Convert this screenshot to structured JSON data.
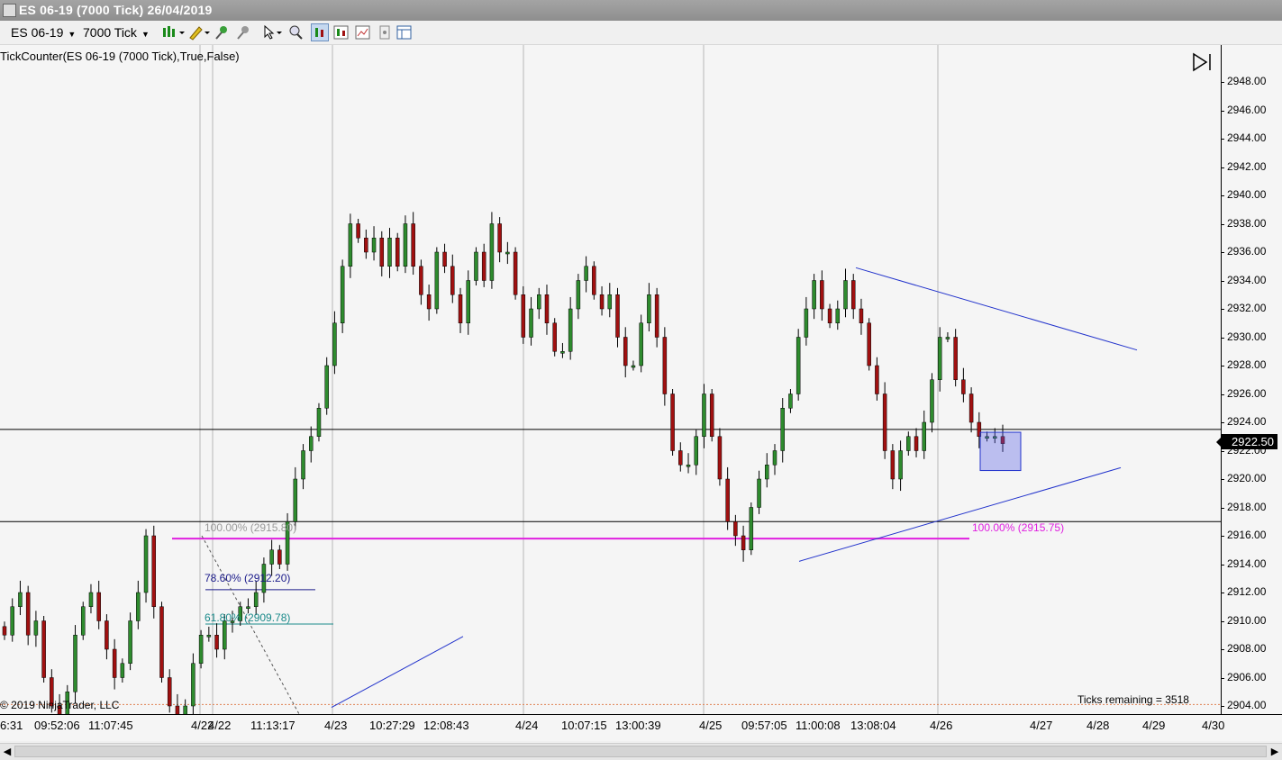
{
  "window": {
    "title": "ES 06-19 (7000 Tick)  26/04/2019"
  },
  "toolbar": {
    "instrument": "ES 06-19",
    "interval": "7000 Tick",
    "icons": [
      "bar-style-icon",
      "drawing-pencil-icon",
      "pin-icon",
      "pin-alt-icon",
      "cursor-icon",
      "zoom-icon",
      "chart-type-icon",
      "candlestick-icon",
      "data-box-icon",
      "properties-icon",
      "layout-icon"
    ]
  },
  "indicator": {
    "label": "TickCounter(ES  06-19 (7000  Tick),True,False)"
  },
  "panel": {
    "f_button": "F"
  },
  "y_axis": {
    "labels": [
      "2948.00",
      "2946.00",
      "2944.00",
      "2942.00",
      "2940.00",
      "2938.00",
      "2936.00",
      "2934.00",
      "2932.00",
      "2930.00",
      "2928.00",
      "2926.00",
      "2924.00",
      "2922.00",
      "2920.00",
      "2918.00",
      "2916.00",
      "2914.00",
      "2912.00",
      "2910.00",
      "2908.00",
      "2906.00",
      "2904.00"
    ],
    "current_price": "2922.50"
  },
  "x_axis": {
    "labels": [
      "6:31",
      "09:52:06",
      "11:07:45",
      "4/22",
      "4/22",
      "11:13:17",
      "4/23",
      "10:27:29",
      "12:08:43",
      "4/24",
      "10:07:15",
      "13:00:39",
      "4/25",
      "09:57:05",
      "11:00:08",
      "13:08:04",
      "4/26",
      "4/27",
      "4/28",
      "4/29",
      "4/30"
    ]
  },
  "fib_labels": {
    "left_100": "100.00% (2915.80)",
    "left_786": "78.60% (2912.20)",
    "left_618": "61.80% (2909.78)",
    "right_100": "100.00% (2915.75)"
  },
  "footer": {
    "copyright": "© 2019 NinjaTrader, LLC",
    "ticks_remaining": "Ticks remaining = 3518"
  },
  "colors": {
    "up_candle": "#2e8b2e",
    "down_candle": "#a01010",
    "trendline": "#2233cc",
    "fib_level": "#e020e0",
    "fib_786": "#1a1a8a",
    "fib_618": "#1a8a8a"
  },
  "chart_data": {
    "type": "candlestick",
    "y_range": [
      2903,
      2950
    ],
    "current_price": 2922.5,
    "horizontal_lines": [
      2923.5,
      2917.0
    ],
    "fib_levels": [
      2915.8,
      2912.2,
      2909.78,
      2915.75
    ],
    "closes": [
      2909,
      2911,
      2912,
      2909,
      2910,
      2906,
      2904,
      2903,
      2905,
      2909,
      2911,
      2912,
      2910,
      2908,
      2906,
      2907,
      2910,
      2912,
      2916,
      2911,
      2906,
      2904,
      2902,
      2904,
      2907,
      2909,
      2909,
      2908,
      2910,
      2910,
      2911,
      2911,
      2912,
      2914,
      2915,
      2914,
      2917,
      2920,
      2922,
      2923,
      2925,
      2928,
      2931,
      2935,
      2938,
      2937,
      2936,
      2937,
      2935,
      2937,
      2935,
      2938,
      2935,
      2933,
      2932,
      2936,
      2935,
      2933,
      2931,
      2934,
      2936,
      2934,
      2938,
      2936,
      2936,
      2933,
      2930,
      2932,
      2933,
      2931,
      2929,
      2929,
      2932,
      2934,
      2935,
      2933,
      2932,
      2933,
      2930,
      2928,
      2928,
      2931,
      2933,
      2930,
      2926,
      2922,
      2921,
      2921,
      2923,
      2926,
      2923,
      2920,
      2917,
      2916,
      2915,
      2918,
      2920,
      2921,
      2922,
      2925,
      2926,
      2930,
      2932,
      2934,
      2932,
      2931,
      2932,
      2934,
      2932,
      2931,
      2928,
      2926,
      2922,
      2920,
      2922,
      2923,
      2922,
      2924,
      2927,
      2930,
      2930,
      2927,
      2926,
      2924,
      2923,
      2923,
      2923,
      2922.5
    ]
  }
}
